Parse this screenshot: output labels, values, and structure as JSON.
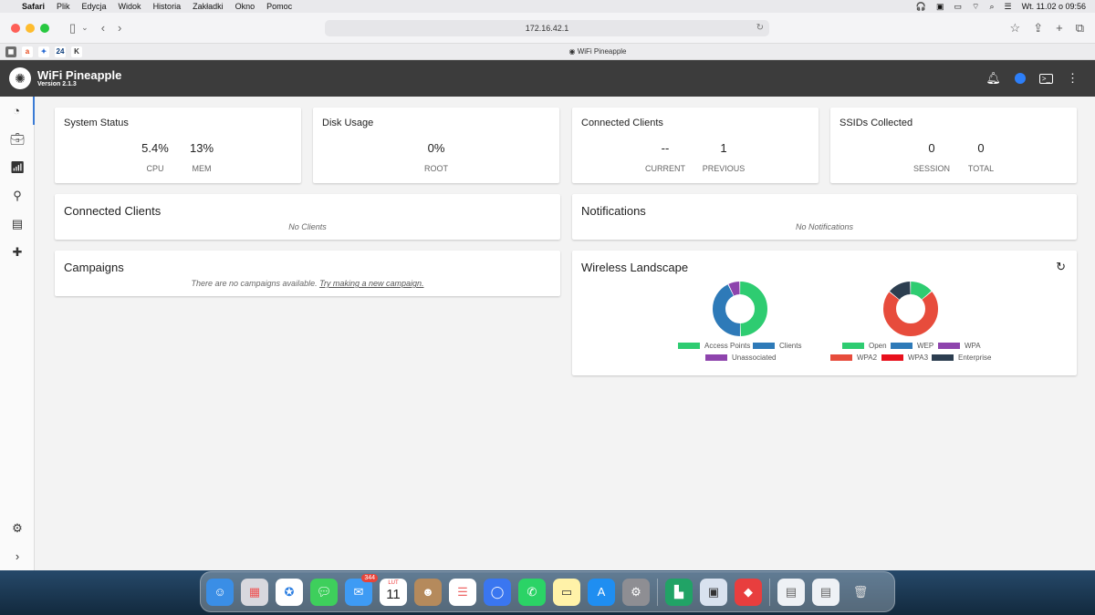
{
  "menubar": {
    "items": [
      "Safari",
      "Plik",
      "Edycja",
      "Widok",
      "Historia",
      "Zakładki",
      "Okno",
      "Pomoc"
    ],
    "clock": "Wt. 11.02 o 09:56"
  },
  "browser": {
    "url": "172.16.42.1",
    "tab_title": "WiFi Pineapple",
    "bookmarks": [
      "a",
      "24",
      "K"
    ]
  },
  "app": {
    "name": "WiFi Pineapple",
    "version": "Version 2.1.3"
  },
  "cards": {
    "system_status": {
      "title": "System Status",
      "cpu_val": "5.4%",
      "cpu_lbl": "CPU",
      "mem_val": "13%",
      "mem_lbl": "MEM"
    },
    "disk_usage": {
      "title": "Disk Usage",
      "root_val": "0%",
      "root_lbl": "ROOT"
    },
    "connected_clients_stat": {
      "title": "Connected Clients",
      "current_val": "--",
      "current_lbl": "CURRENT",
      "previous_val": "1",
      "previous_lbl": "PREVIOUS"
    },
    "ssids": {
      "title": "SSIDs Collected",
      "session_val": "0",
      "session_lbl": "SESSION",
      "total_val": "0",
      "total_lbl": "TOTAL"
    },
    "clients": {
      "title": "Connected Clients",
      "empty": "No Clients"
    },
    "notifications": {
      "title": "Notifications",
      "empty": "No Notifications"
    },
    "campaigns": {
      "title": "Campaigns",
      "empty": "There are no campaigns available.",
      "link": "Try making a new campaign."
    },
    "wireless": {
      "title": "Wireless Landscape"
    }
  },
  "chart_data": [
    {
      "type": "pie",
      "donut": true,
      "categories": [
        "Access Points",
        "Clients",
        "Unassociated"
      ],
      "values": [
        50,
        43,
        7
      ],
      "colors": [
        "#2ecc71",
        "#2e7ab8",
        "#8e44ad"
      ]
    },
    {
      "type": "pie",
      "donut": true,
      "categories": [
        "Open",
        "WEP",
        "WPA",
        "WPA2",
        "WPA3",
        "Enterprise"
      ],
      "values": [
        14,
        0,
        0,
        72,
        0,
        14
      ],
      "colors": [
        "#2ecc71",
        "#2e7ab8",
        "#8e44ad",
        "#e74c3c",
        "#e8101c",
        "#2c3e50"
      ]
    }
  ],
  "dock": {
    "mail_badge": "344",
    "cal_month": "LUT",
    "cal_day": "11"
  }
}
